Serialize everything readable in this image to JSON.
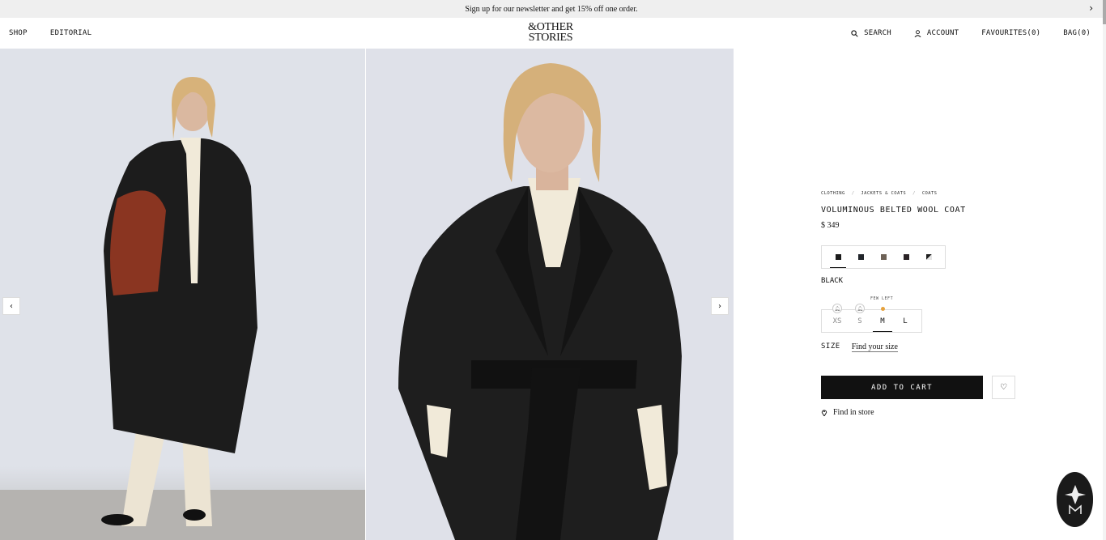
{
  "announcement": {
    "text": "Sign up for our newsletter and get 15% off one order."
  },
  "header": {
    "nav_left": [
      "SHOP",
      "EDITORIAL"
    ],
    "logo_line1": "&OTHER",
    "logo_line2": "STORIES",
    "search": "SEARCH",
    "account": "ACCOUNT",
    "favourites": "FAVOURITES(0)",
    "bag": "BAG(0)"
  },
  "gallery": {
    "prev_icon": "chevron-left-icon",
    "next_icon": "chevron-right-icon"
  },
  "product": {
    "breadcrumb": [
      "CLOTHING",
      "JACKETS & COATS",
      "COATS"
    ],
    "title": "VOLUMINOUS BELTED WOOL COAT",
    "price": "$ 349",
    "swatches": [
      "#1b1b1b",
      "#22252b",
      "#6e6257",
      "#2a2326",
      "#1d1d1d"
    ],
    "selected_color": "BLACK",
    "few_left": "FEW LEFT",
    "sizes": [
      "XS",
      "S",
      "M",
      "L"
    ],
    "size_label": "SIZE",
    "find_size": "Find your size",
    "add_to_cart": "ADD TO CART",
    "find_in_store": "Find in store"
  },
  "colors": {
    "accent_dot": "#e6a23c",
    "cart_bg": "#111111"
  }
}
